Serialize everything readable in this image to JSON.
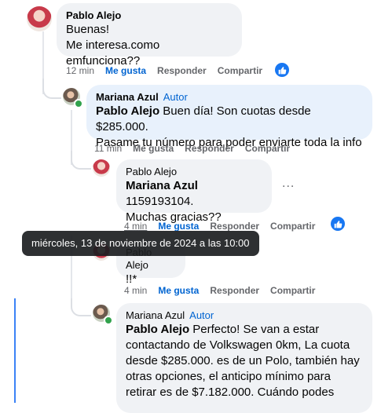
{
  "colors": {
    "link": "#0064d1",
    "bubble": "#f0f2f5",
    "reaction": "#1877f2"
  },
  "comments": [
    {
      "author": "Pablo Alejo",
      "badge": "",
      "lines": [
        "Buenas!",
        "Me interesa.como emfunciona??"
      ],
      "mention": "",
      "time": "12 min",
      "like": "Me gusta",
      "reply": "Responder",
      "share": "Compartir"
    },
    {
      "author": "Mariana Azul",
      "badge": "Autor",
      "mention": "Pablo Alejo",
      "lines": [
        " Buen día! Son cuotas desde $285.000.",
        "Pasame tu número para poder enviarte toda la info"
      ],
      "time": "11 min",
      "like": "Me gusta",
      "reply": "Responder",
      "share": "Compartir"
    },
    {
      "author": "Pablo Alejo",
      "badge": "",
      "mention": "Mariana Azul",
      "lines": [
        " 1159193104.",
        "Muchas gracias??"
      ],
      "time": "4 min",
      "like": "Me gusta",
      "reply": "Responder",
      "share": "Compartir",
      "more": "..."
    },
    {
      "author": "Pablo Alejo",
      "badge": "",
      "mention": "",
      "lines": [
        "!!*"
      ],
      "time": "4 min",
      "like": "Me gusta",
      "reply": "Responder",
      "share": "Compartir"
    },
    {
      "author": "Mariana Azul",
      "badge": "Autor",
      "mention": "Pablo Alejo",
      "lines": [
        " Perfecto! Se van a estar",
        "contactando de Volkswagen 0km, La cuota",
        "desde $285.000. es de un Polo, también hay",
        "otras opciones, el anticipo mínimo para",
        "retirar es de $7.182.000. Cuándo podes"
      ]
    }
  ],
  "tooltip": "miércoles, 13 de noviembre de 2024 a las 10:00"
}
